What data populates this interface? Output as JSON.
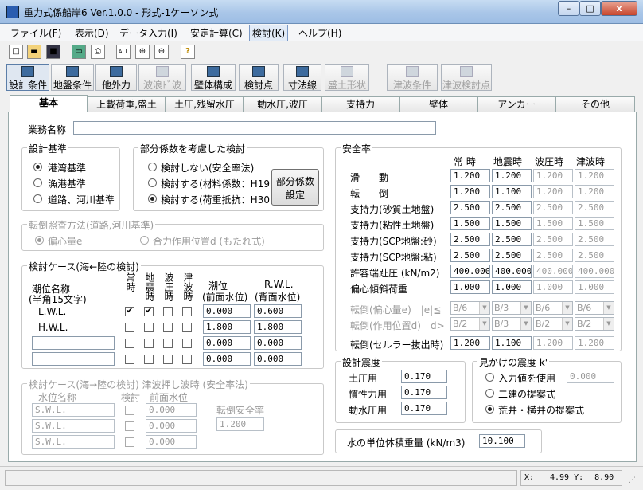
{
  "window": {
    "title": "重力式係船岸6 Ver.1.0.0 - 形式-1ケーソン式",
    "min": "–",
    "max": "□",
    "close": "x"
  },
  "menu": [
    "ファイル(F)",
    "表示(D)",
    "データ入力(I)",
    "安定計算(C)",
    "検討(K)",
    "ヘルプ(H)"
  ],
  "toolbar1": [
    "new-icon",
    "open-icon",
    "save-icon",
    "screen-icon",
    "print-icon",
    "all-icon",
    "zoom-in-icon",
    "zoom-out-icon",
    "help-icon"
  ],
  "toolbar1_glyphs": [
    "□",
    "▬",
    "■",
    "▭",
    "⎙",
    "ALL",
    "⊕",
    "⊖",
    "?"
  ],
  "toolbar2": [
    "設計条件",
    "地盤条件",
    "他外力",
    "波浪ﾄﾞ波",
    "壁体構成",
    "検討点",
    "寸法線",
    "盛土形状",
    "津波条件",
    "津波検討点"
  ],
  "tabs": [
    "基本",
    "上載荷重,盛土",
    "土圧,残留水圧",
    "動水圧,波圧",
    "支持力",
    "壁体",
    "アンカー",
    "その他"
  ],
  "gyomu": {
    "label": "業務名称",
    "value": ""
  },
  "sekkei": {
    "title": "設計基準",
    "options": [
      "港湾基準",
      "漁港基準",
      "道路、河川基準"
    ]
  },
  "bubun": {
    "title": "部分係数を考慮した検討",
    "options": [
      "検討しない(安全率法)",
      "検討する(材料係数：H19)",
      "検討する(荷重抵抗：H30)"
    ],
    "button1": "部分係数",
    "button2": "設定"
  },
  "tentou": {
    "title": "転倒照査方法(道路,河川基準)",
    "options": [
      "偏心量e",
      "合力作用位置d (もたれ式)"
    ]
  },
  "case1": {
    "title": "検討ケース(海←陸の検討)",
    "col_name1": "潮位名称",
    "col_name2": "(半角15文字)",
    "flags": [
      "常時",
      "地震時",
      "波圧時",
      "津波時"
    ],
    "col_tide1": "潮位",
    "col_tide2": "(前面水位)",
    "col_rwl1": "R.W.L.",
    "col_rwl2": "(背面水位)",
    "rows": [
      {
        "name": "L.W.L.",
        "tide": "0.000",
        "rwl": "0.600",
        "checks": [
          "✔",
          "✔",
          "",
          ""
        ]
      },
      {
        "name": "H.W.L.",
        "tide": "1.800",
        "rwl": "1.800",
        "checks": [
          "",
          "",
          "",
          ""
        ]
      },
      {
        "name": "",
        "tide": "0.000",
        "rwl": "0.000",
        "checks": [
          "",
          "",
          "",
          ""
        ]
      },
      {
        "name": "",
        "tide": "0.000",
        "rwl": "0.000",
        "checks": [
          "",
          "",
          "",
          ""
        ]
      }
    ]
  },
  "case2": {
    "title": "検討ケース(海→陸の検討) 津波押し波時 (安全率法)",
    "col_name": "水位名称",
    "col_check": "検討",
    "col_front": "前面水位",
    "col_safety": "転倒安全率",
    "safety": "1.200",
    "rows": [
      {
        "name": "S.W.L.",
        "value": "0.000"
      },
      {
        "name": "S.W.L.",
        "value": "0.000"
      },
      {
        "name": "S.W.L.",
        "value": "0.000"
      }
    ]
  },
  "anzen": {
    "title": "安全率",
    "cols": [
      "常 時",
      "地震時",
      "波圧時",
      "津波時"
    ],
    "rows": [
      {
        "label": "滑　　動",
        "v": [
          "1.200",
          "1.200",
          "1.200",
          "1.200"
        ]
      },
      {
        "label": "転　　倒",
        "v": [
          "1.200",
          "1.100",
          "1.200",
          "1.200"
        ]
      },
      {
        "label": "支持力(砂質土地盤)",
        "v": [
          "2.500",
          "2.500",
          "2.500",
          "2.500"
        ]
      },
      {
        "label": "支持力(粘性土地盤)",
        "v": [
          "1.500",
          "1.500",
          "1.500",
          "1.500"
        ]
      },
      {
        "label": "支持力(SCP地盤:砂)",
        "v": [
          "2.500",
          "2.500",
          "2.500",
          "2.500"
        ]
      },
      {
        "label": "支持力(SCP地盤:粘)",
        "v": [
          "2.500",
          "2.500",
          "2.500",
          "2.500"
        ]
      },
      {
        "label": "許容端趾圧 (kN/m2)",
        "v": [
          "400.000",
          "400.000",
          "400.000",
          "400.000"
        ]
      },
      {
        "label": "偏心傾斜荷重",
        "v": [
          "1.000",
          "1.000",
          "1.000",
          "1.000"
        ]
      }
    ],
    "sel_rows": [
      {
        "label": "転倒(偏心量e)　|e|≦",
        "v": [
          "B/6",
          "B/3",
          "B/6",
          "B/6"
        ]
      },
      {
        "label": "転倒(作用位置d)　d>",
        "v": [
          "B/2",
          "B/3",
          "B/2",
          "B/2"
        ]
      }
    ],
    "last": {
      "label": "転倒(セルラー抜出時)",
      "v": [
        "1.200",
        "1.100",
        "1.200",
        "1.200"
      ]
    }
  },
  "shindo": {
    "title": "設計震度",
    "rows": [
      {
        "label": "土圧用",
        "v": "0.170"
      },
      {
        "label": "慣性力用",
        "v": "0.170"
      },
      {
        "label": "動水圧用",
        "v": "0.170"
      }
    ]
  },
  "mikake": {
    "title": "見かけの震度 k'",
    "options": [
      "入力値を使用",
      "二建の提案式",
      "荒井・横井の提案式"
    ],
    "value": "0.000"
  },
  "water": {
    "label": "水の単位体積重量 (kN/m3)",
    "value": "10.100"
  },
  "status": {
    "x_label": "X:",
    "x": "4.99",
    "y_label": "Y:",
    "y": "8.90"
  }
}
